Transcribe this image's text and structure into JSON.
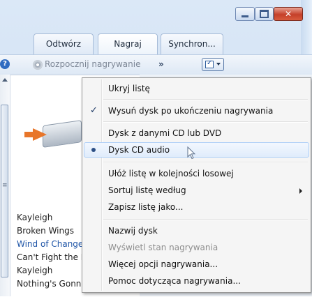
{
  "tabs": [
    {
      "label": "Odtwórz"
    },
    {
      "label": "Nagraj"
    },
    {
      "label": "Synchron..."
    }
  ],
  "toolbar": {
    "burn_label": "Rozpocznij nagrywanie",
    "chevron": "»",
    "help_glyph": "?"
  },
  "tracks": [
    {
      "label": "Kayleigh"
    },
    {
      "label": "Broken Wings"
    },
    {
      "label": "Wind of Change"
    },
    {
      "label": "Can't Fight the Moonlight"
    },
    {
      "label": "Kayleigh"
    },
    {
      "label": "Nothing's Gonna Stop Us Now"
    }
  ],
  "menu": {
    "items": [
      {
        "label": "Ukryj listę"
      },
      {
        "label": "Wysuń dysk po ukończeniu nagrywania",
        "checked": true
      },
      {
        "label": "Dysk z danymi CD lub DVD"
      },
      {
        "label": "Dysk CD audio",
        "selected": true
      },
      {
        "label": "Ułóż listę w kolejności losowej"
      },
      {
        "label": "Sortuj listę według",
        "submenu": true
      },
      {
        "label": "Zapisz listę jako..."
      },
      {
        "label": "Nazwij dysk"
      },
      {
        "label": "Wyświetl stan nagrywania",
        "disabled": true
      },
      {
        "label": "Więcej opcji nagrywania..."
      },
      {
        "label": "Pomoc dotycząca nagrywania..."
      }
    ]
  },
  "icons": {
    "minimize": "minimize-icon",
    "maximize": "maximize-icon",
    "close": "close-icon",
    "help": "help-icon",
    "burn": "burn-disc-icon",
    "options": "list-options-icon",
    "drive": "cd-drive-icon",
    "cursor": "mouse-pointer-icon"
  },
  "colors": {
    "close_button": "#c5402a",
    "menu_hover_border": "#aecff7",
    "playing_track": "#1f55a7"
  }
}
